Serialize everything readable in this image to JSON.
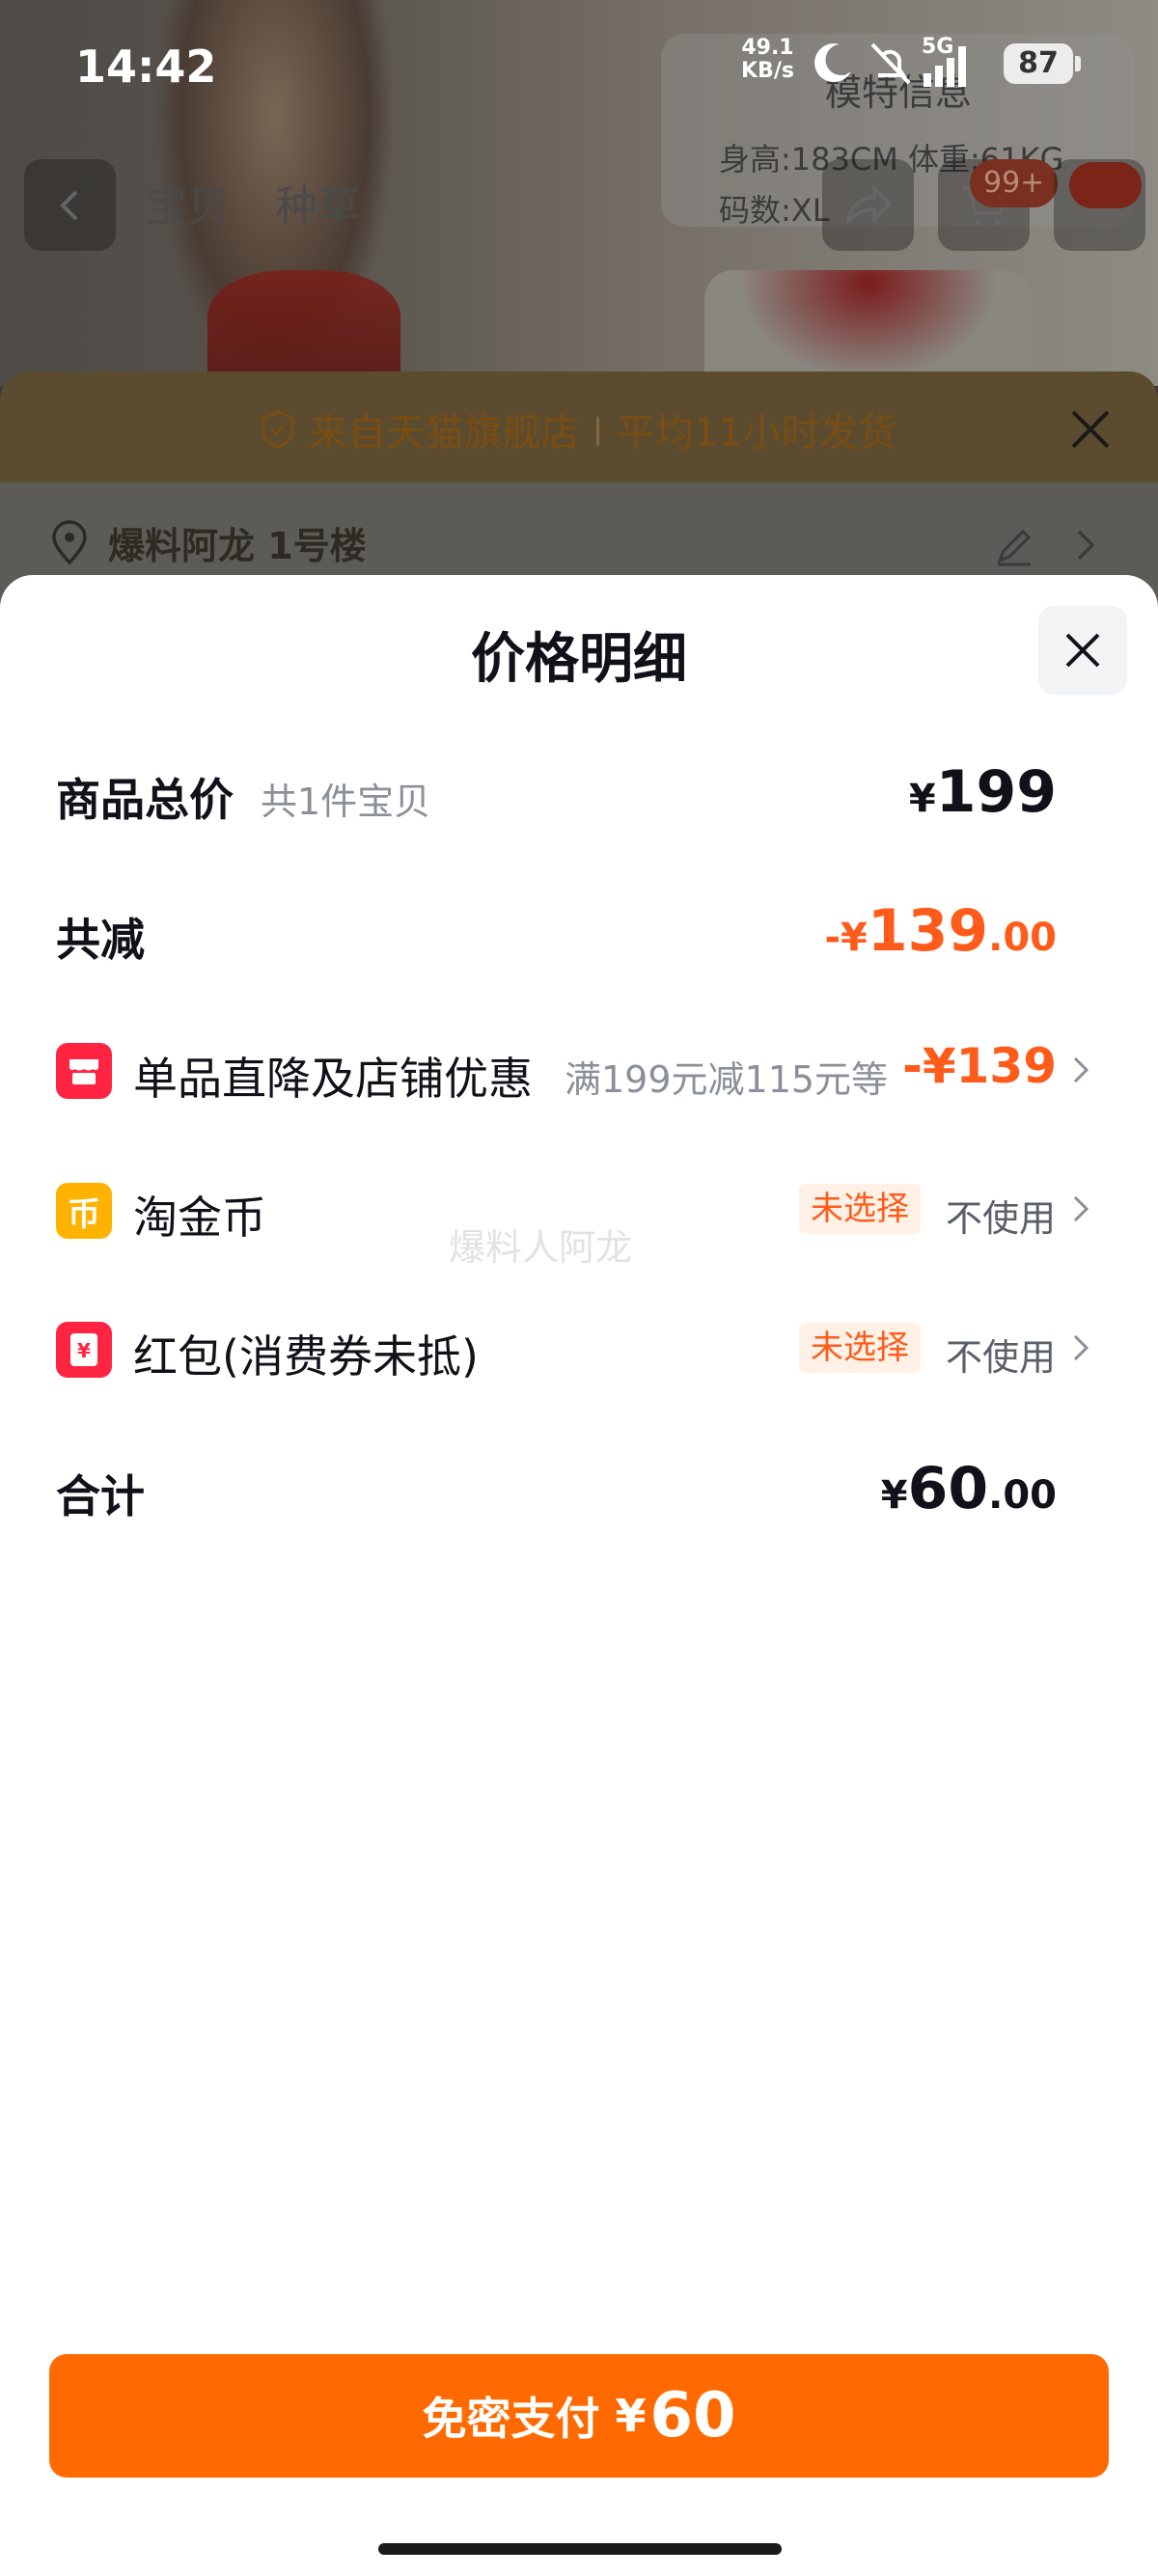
{
  "status_bar": {
    "time": "14:42",
    "net_speed_value": "49.1",
    "net_speed_unit": "KB/s",
    "network": "5G",
    "battery": "87"
  },
  "background": {
    "nav_tabs": [
      "宝贝",
      "种草"
    ],
    "cart_badge": "99+",
    "model_info": {
      "title": "模特信息",
      "line1": "身高:183CM  体重:61KG",
      "line2": "码数:XL"
    }
  },
  "under_sheet": {
    "banner_left": "来自天猫旗舰店",
    "banner_right": "平均11小时发货",
    "address": "爆料阿龙 1号楼"
  },
  "price_sheet": {
    "title": "价格明细",
    "total": {
      "label": "商品总价",
      "sub": "共1件宝贝",
      "currency": "¥",
      "amount": "199"
    },
    "reduction": {
      "label": "共减",
      "prefix": "-¥",
      "amount": "139",
      "decimal": ".00"
    },
    "discount": {
      "label": "单品直降及店铺优惠",
      "sub": "满199元减115元等",
      "value": "-¥139"
    },
    "coins": {
      "label": "淘金币",
      "tag": "未选择",
      "status": "不使用",
      "icon": "coin-icon"
    },
    "redpacket": {
      "label": "红包(消费券未抵)",
      "tag": "未选择",
      "status": "不使用",
      "icon": "redpacket-icon"
    },
    "sum": {
      "label": "合计",
      "currency": "¥",
      "amount": "60",
      "decimal": ".00"
    },
    "watermark": "爆料人阿龙"
  },
  "pay_button": {
    "label": "免密支付",
    "currency": "¥",
    "amount": "60"
  },
  "colors": {
    "accent": "#ff6a00",
    "discount": "#ff5b1a",
    "shop_icon": "#ff2441",
    "coin_icon": "#ffb300"
  }
}
